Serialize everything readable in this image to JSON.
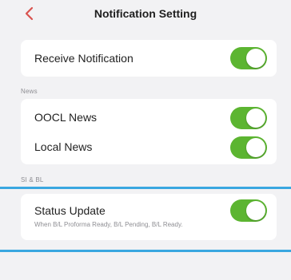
{
  "header": {
    "title": "Notification Setting",
    "back_icon": "chevron-left-icon",
    "accent_color": "#d9534f"
  },
  "receive_notification": {
    "label": "Receive Notification",
    "enabled": true
  },
  "sections": [
    {
      "header": "News",
      "items": [
        {
          "label": "OOCL News",
          "enabled": true
        },
        {
          "label": "Local News",
          "enabled": true
        }
      ]
    },
    {
      "header": "SI & BL",
      "items": [
        {
          "label": "Status Update",
          "description": "When B/L Proforma Ready, B/L Pending, B/L Ready.",
          "enabled": true
        }
      ]
    }
  ],
  "colors": {
    "toggle_on": "#5cb531",
    "focus_line": "#3aa7e0",
    "background": "#f2f2f4"
  }
}
